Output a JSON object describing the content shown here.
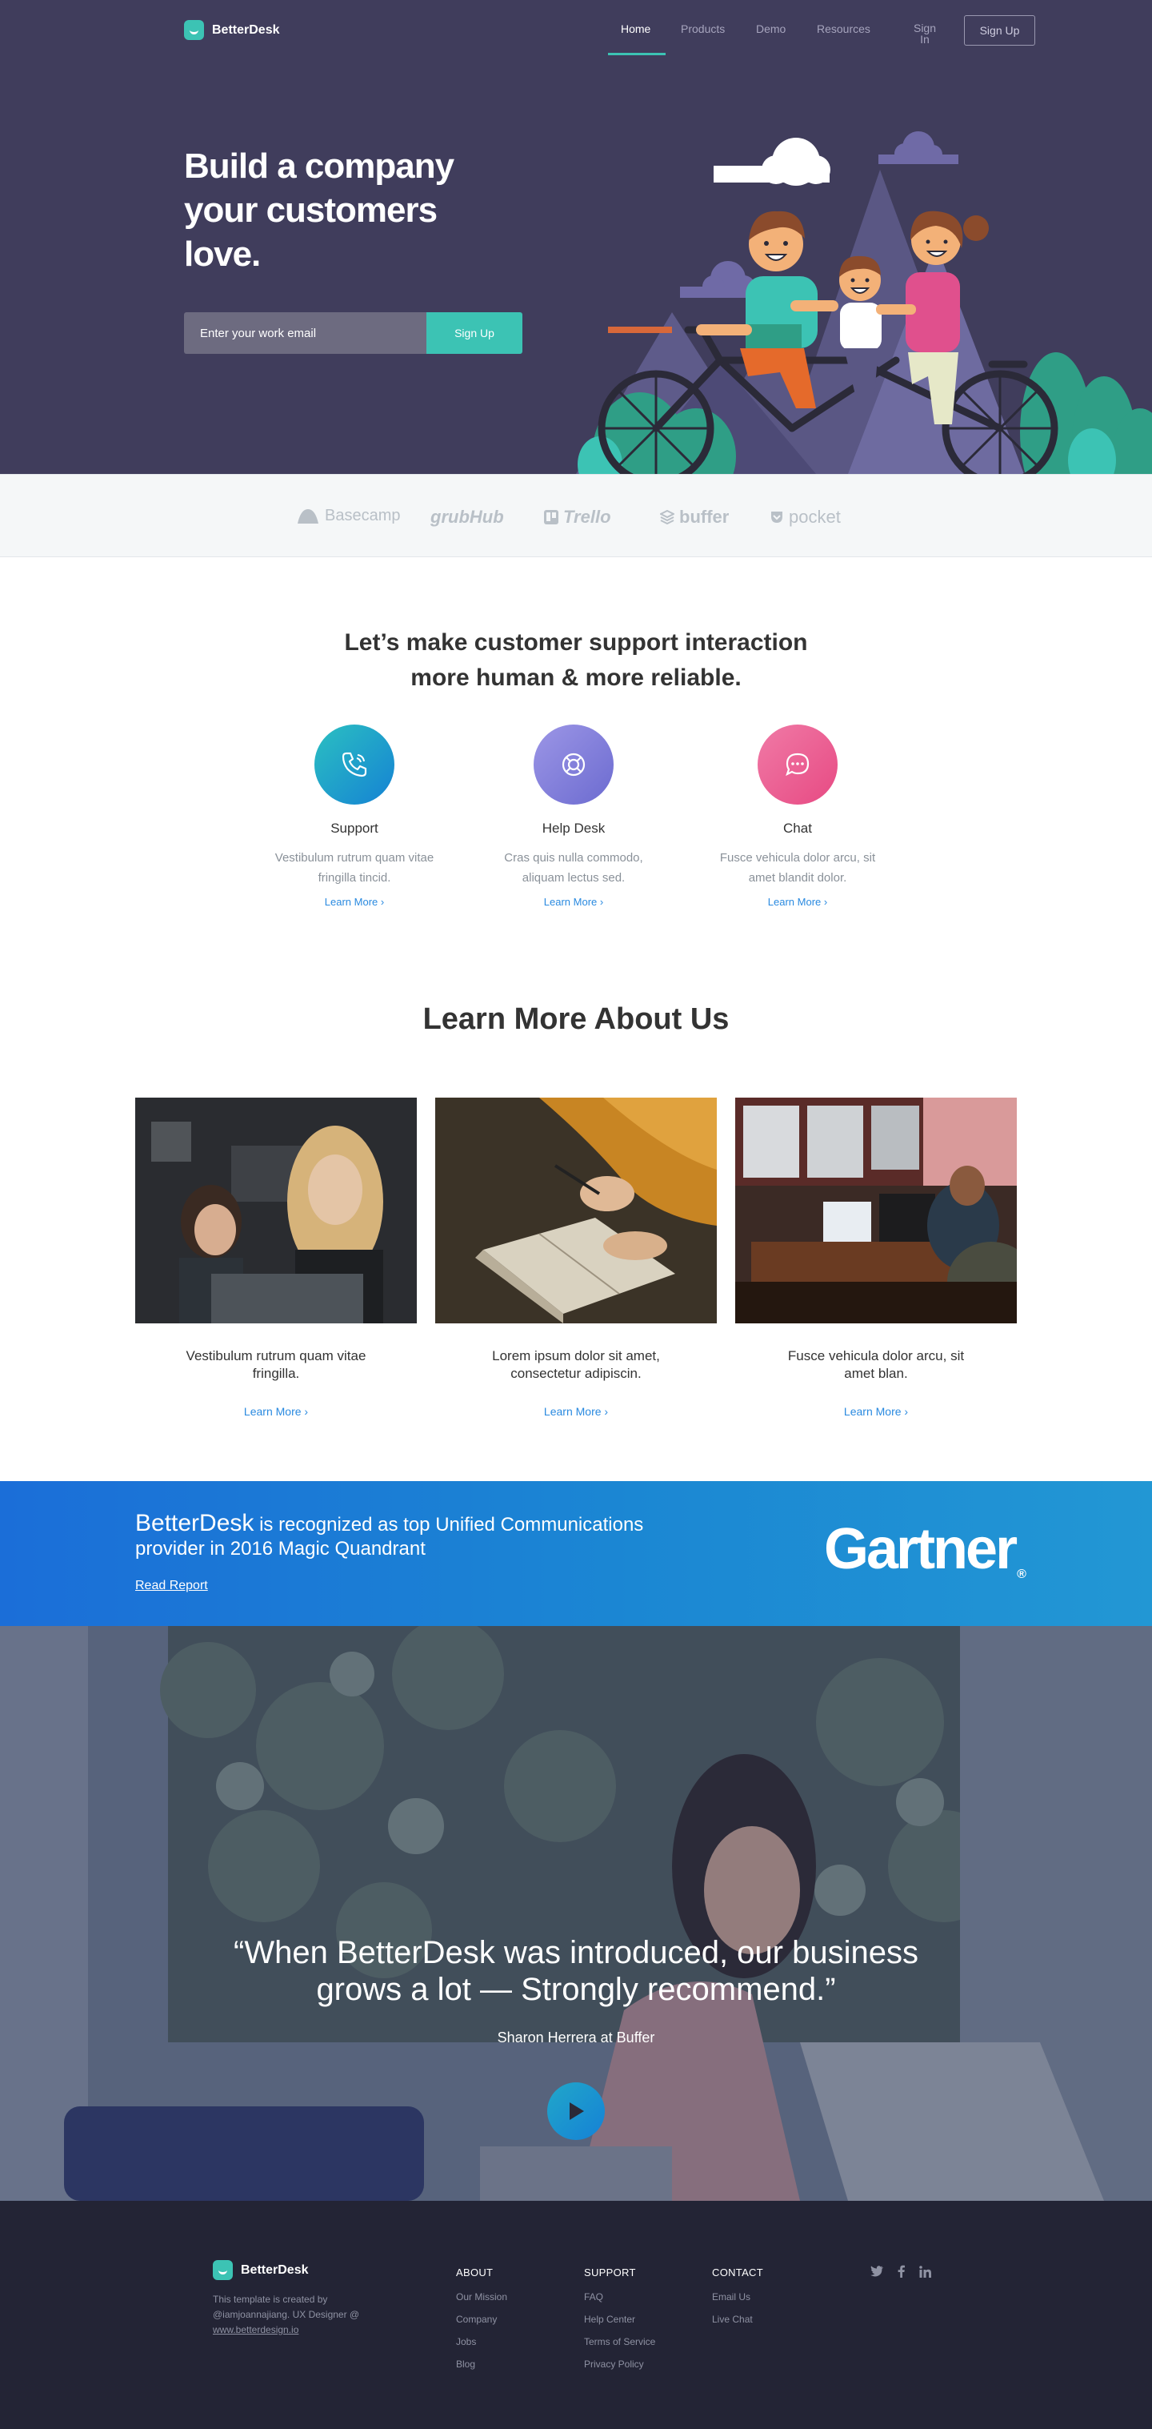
{
  "brand": {
    "name": "BetterDesk",
    "accent": "#3cc3b4",
    "hero_bg": "#403d5c",
    "footer_bg": "#232435"
  },
  "nav": {
    "items": [
      {
        "label": "Home",
        "active": true
      },
      {
        "label": "Products"
      },
      {
        "label": "Demo"
      },
      {
        "label": "Resources"
      },
      {
        "label": "Sign In"
      }
    ],
    "signup_label": "Sign Up"
  },
  "hero": {
    "title": "Build a company your customers love.",
    "email_placeholder": "Enter your work email",
    "cta_label": "Sign Up"
  },
  "clients": [
    "Basecamp",
    "grubHub",
    "Trello",
    "buffer",
    "pocket"
  ],
  "features": {
    "title_line1": "Let’s make customer support interaction",
    "title_line2": "more human & more reliable.",
    "items": [
      {
        "name": "Support",
        "desc": "Vestibulum rutrum quam vitae fringilla tincid.",
        "link": "Learn More ›",
        "icon": "phone-icon"
      },
      {
        "name": "Help Desk",
        "desc": "Cras quis nulla commodo, aliquam lectus sed.",
        "link": "Learn More ›",
        "icon": "lifebuoy-icon"
      },
      {
        "name": "Chat",
        "desc": "Fusce vehicula dolor arcu, sit amet blandit dolor.",
        "link": "Learn More ›",
        "icon": "chat-bubble-icon"
      }
    ]
  },
  "about": {
    "title": "Learn More About Us",
    "cards": [
      {
        "text": "Vestibulum rutrum quam vitae fringilla.",
        "link": "Learn More ›"
      },
      {
        "text": "Lorem ipsum dolor sit amet, consectetur adipiscin.",
        "link": "Learn More ›"
      },
      {
        "text": "Fusce vehicula dolor arcu, sit amet blan.",
        "link": "Learn More ›"
      }
    ]
  },
  "gartner": {
    "brand": "BetterDesk",
    "text": "is recognized as top Unified Communications provider in 2016 Magic Quandrant",
    "link": "Read Report",
    "logo": "Gartner",
    "logo_mark": "®"
  },
  "testimonial": {
    "quote": "“When BetterDesk was introduced, our business grows a lot — Strongly recommend.”",
    "author": "Sharon Herrera at Buffer"
  },
  "footer": {
    "brand": "BetterDesk",
    "credit": "This template is created by @iamjoannajiang. UX Designer @",
    "credit_link": "www.betterdesign.io",
    "columns": [
      {
        "title": "ABOUT",
        "links": [
          "Our Mission",
          "Company",
          "Jobs",
          "Blog"
        ]
      },
      {
        "title": "SUPPORT",
        "links": [
          "FAQ",
          "Help Center",
          "Terms of Service",
          "Privacy Policy"
        ]
      },
      {
        "title": "CONTACT",
        "links": [
          "Email Us",
          "Live Chat"
        ]
      }
    ],
    "social": [
      "twitter-icon",
      "facebook-icon",
      "linkedin-icon"
    ]
  }
}
